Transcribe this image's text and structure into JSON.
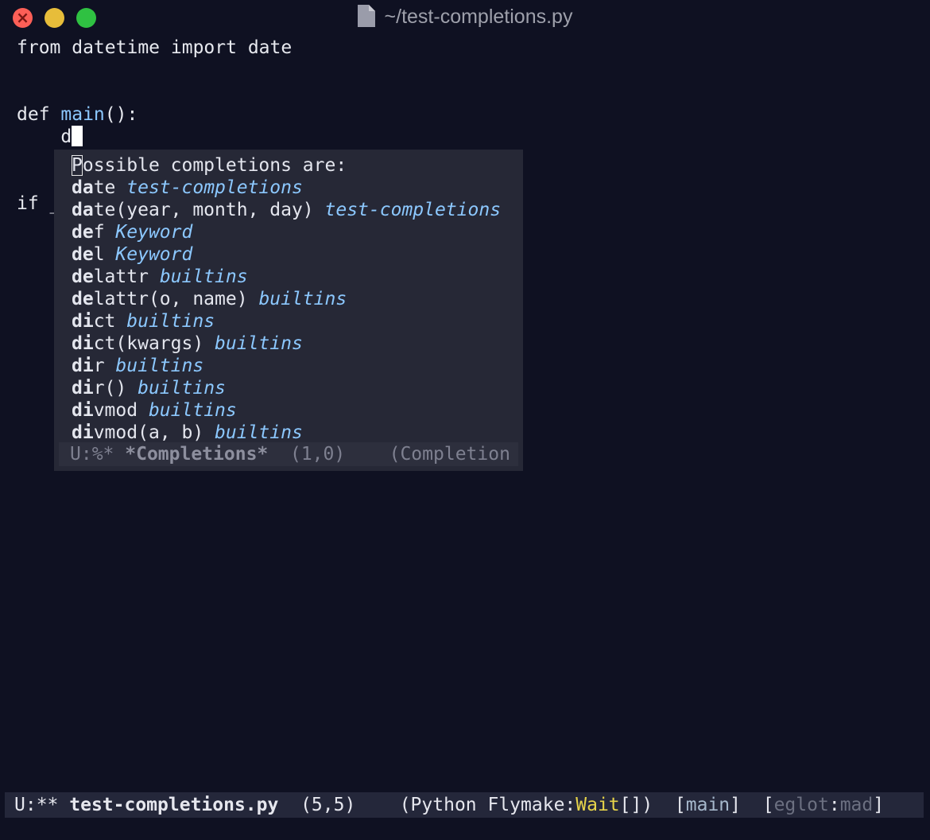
{
  "window": {
    "title": "~/test-completions.py"
  },
  "editor": {
    "line1": {
      "from_kw": "from",
      "module": " datetime ",
      "import_kw": "import",
      "name": " date"
    },
    "line4": {
      "def_kw": "def ",
      "fn_name": "main",
      "rest": "():"
    },
    "line5": {
      "indent": "    ",
      "typed": "d"
    },
    "line8": {
      "text": "if _"
    }
  },
  "completions": {
    "header_first": "P",
    "header_rest": "ossible completions are:",
    "items": [
      {
        "prefix": "da",
        "rest": "te",
        "source": "test-completions"
      },
      {
        "prefix": "da",
        "rest": "te(year, month, day)",
        "source": "test-completions"
      },
      {
        "prefix": "de",
        "rest": "f",
        "source": "Keyword"
      },
      {
        "prefix": "de",
        "rest": "l",
        "source": "Keyword"
      },
      {
        "prefix": "de",
        "rest": "lattr",
        "source": "builtins"
      },
      {
        "prefix": "de",
        "rest": "lattr(o, name)",
        "source": "builtins"
      },
      {
        "prefix": "di",
        "rest": "ct",
        "source": "builtins"
      },
      {
        "prefix": "di",
        "rest": "ct(kwargs)",
        "source": "builtins"
      },
      {
        "prefix": "di",
        "rest": "r",
        "source": "builtins"
      },
      {
        "prefix": "di",
        "rest": "r()",
        "source": "builtins"
      },
      {
        "prefix": "di",
        "rest": "vmod",
        "source": "builtins"
      },
      {
        "prefix": "di",
        "rest": "vmod(a, b)",
        "source": "builtins"
      }
    ],
    "modeline": {
      "status": "U:%*",
      "buffer": "*Completions*",
      "position": "(1,0)",
      "mode": "(Completion"
    }
  },
  "modeline": {
    "status": "U:**",
    "buffer": "test-completions.py",
    "position": "(5,5)",
    "mode_prefix": "(Python Flymake:",
    "flymake_state": "Wait",
    "mode_suffix": "[])",
    "which_func_open": "[",
    "which_func": "main",
    "which_func_close": "]",
    "eglot_open": "[",
    "eglot": "eglot",
    "eglot_sep": ":",
    "eglot_project": "mad",
    "eglot_close": "]"
  }
}
